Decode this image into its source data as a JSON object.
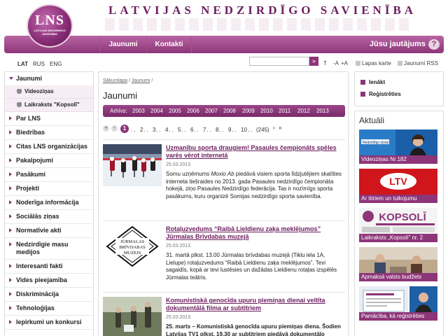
{
  "header": {
    "logo_text": "LNS",
    "logo_subtext": "LATVIJAS NEDZIRDĪGO SAVIENĪBA",
    "site_title": "LATVIJAS NEDZIRDĪGO SAVIENĪBA"
  },
  "nav": {
    "items": [
      {
        "label": "Jaunumi"
      },
      {
        "label": "Kontakti"
      }
    ],
    "questions_label": "Jūsu jautājums",
    "questions_icon": "?"
  },
  "toolbar": {
    "languages": [
      "LAT",
      "RUS",
      "ENG"
    ],
    "search_value": "",
    "search_button": "»",
    "font_t": "T",
    "font_smaller": "-A",
    "font_larger": "+A",
    "sitemap": "Lapas karte",
    "rss": "Jaunumi RSS"
  },
  "sidebar": {
    "items": [
      {
        "label": "Jaunumi"
      },
      {
        "label": "Videoziņas"
      },
      {
        "label": "Laikraksts \"Kopsolī\""
      },
      {
        "label": "Par LNS"
      },
      {
        "label": "Biedrības"
      },
      {
        "label": "Citas LNS organizācijas"
      },
      {
        "label": "Pakalpojumi"
      },
      {
        "label": "Pasākumi"
      },
      {
        "label": "Projekti"
      },
      {
        "label": "Noderīga informācija"
      },
      {
        "label": "Sociālās ziņas"
      },
      {
        "label": "Normatīvie akti"
      },
      {
        "label": "Nedzirdīgie masu medijos"
      },
      {
        "label": "Interesanti fakti"
      },
      {
        "label": "Vides pieejamība"
      },
      {
        "label": "Diskriminācija"
      },
      {
        "label": "Tehnoloģijas"
      },
      {
        "label": "Iepirkumi un konkursi"
      }
    ]
  },
  "main": {
    "breadcrumb": [
      "Sākumlapa",
      "/",
      "Jaunumi",
      "/"
    ],
    "title": "Jaunumi",
    "archive_label": "Arhīvs:",
    "years": [
      "2003",
      "2004",
      "2005",
      "2006",
      "2007",
      "2008",
      "2009",
      "2010",
      "2011",
      "2012",
      "2013"
    ],
    "pager": {
      "first": "«",
      "prev": "‹",
      "current": "1",
      "pages": [
        "2",
        "3",
        "4",
        "5",
        "6",
        "7",
        "8",
        "9",
        "10",
        "(245)"
      ],
      "separator": ". .",
      "next": "›",
      "last": "»"
    },
    "articles": [
      {
        "title": "Uzmanību sporta draugiem! Pasaules čempionāts spēles varēs vērot internetā",
        "date": "25.03.2013",
        "text_parts": [
          "Somu uzņēmums ",
          "Moxio Ab",
          " piedāvā visiem sporta līdzjutējiem skatīties interneta tiešraides no 2013. gada Pasaules nedzirdīgo čempionāta hokejā, ziņo Pasaules Nedzirdīgo federācija. Tas ir nozīmīgs sporta pasākums, kuru organizē Somijas nedzirdīgo sporta savienība."
        ]
      },
      {
        "title": "Rotaļuzvedums “Raibā Lieldienu zaķa meklējumos” Jūrmalas Brīvdabas muzejā",
        "date": "25.03.2013",
        "text": "31. martā plkst. 13.00 Jūrmalas brīvdabas muzejā (Tiklu iela 1A, Lielupe) rotaļuzvedums “Raibā Lieldienu zaķa meklējumos”. Tevi sagaidīs, kopā ar tevi lustēsies un dažādas Lieldienu rotaļas izspēlēs Jūrmalas teātris.",
        "logo_lines": [
          "JŪRMALAS",
          "BRĪVDABAS",
          "MUZEJS"
        ]
      },
      {
        "title": "Komunistiskā genocīda upuru piemiņas dienai veltīta dokumentālā filma ar subtitriem",
        "date": "25.03.2013",
        "text": "25. marts – Komunistiskā genocīda upuru piemiņas diena. Šodien Latvijas TV1 plkst. 19.30 ar subtitriem piedāvā dokumentālo"
      }
    ]
  },
  "right": {
    "login": "Ienākt",
    "register": "Reģistrēties",
    "aktuali_title": "Aktuāli",
    "tiles": [
      {
        "caption": "Videoziņas Nr.182",
        "banner": "Nedzirdīgo ziņas"
      },
      {
        "caption": "Ar titriem un tulkojumu",
        "banner": "LTV"
      },
      {
        "caption": "Laikraksts „Kopsolī” nr. 2",
        "banner": "KOPSOLĪ"
      },
      {
        "caption": "Apmaksā valsts budžets"
      },
      {
        "caption": "Pamācība, kā reģistrēties"
      }
    ]
  },
  "colors": {
    "brand_purple": "#8d3579",
    "title_purple": "#6b1e5e",
    "submenu_bg": "#f6eef4",
    "ltv_red": "#d0151b"
  }
}
